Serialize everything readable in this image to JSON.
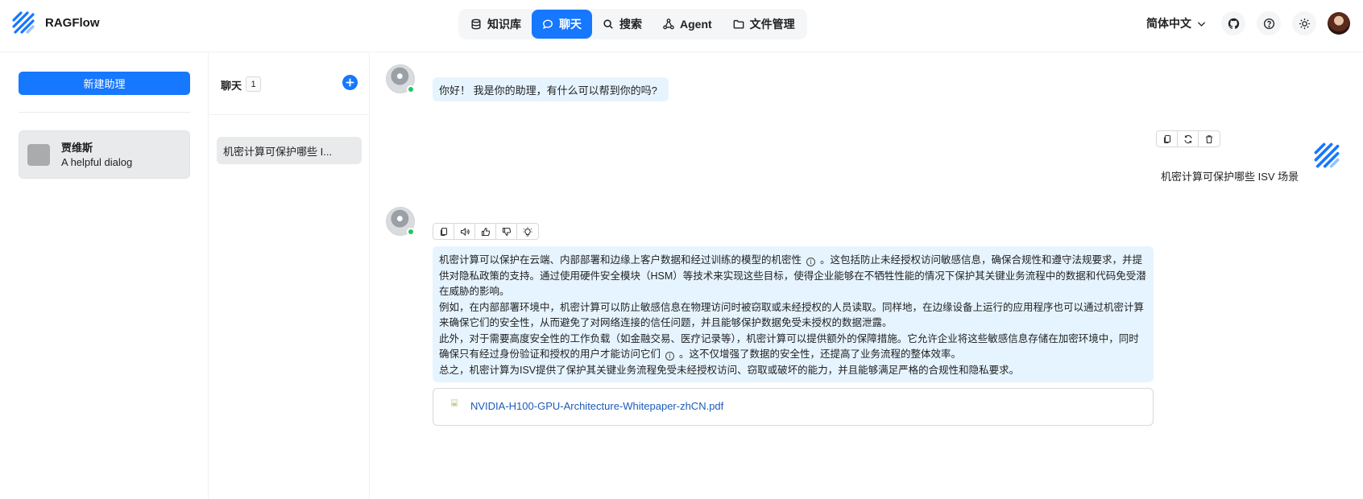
{
  "app": {
    "name": "RAGFlow"
  },
  "nav": {
    "items": [
      {
        "label": "知识库",
        "icon": "database-icon",
        "active": false
      },
      {
        "label": "聊天",
        "icon": "chat-bubble-icon",
        "active": true
      },
      {
        "label": "搜索",
        "icon": "search-icon",
        "active": false
      },
      {
        "label": "Agent",
        "icon": "agent-graph-icon",
        "active": false
      },
      {
        "label": "文件管理",
        "icon": "folder-icon",
        "active": false
      }
    ]
  },
  "header": {
    "language": "简体中文",
    "icons": [
      "github-icon",
      "help-icon",
      "theme-sun-icon",
      "user-avatar"
    ]
  },
  "sidebar": {
    "new_assistant_label": "新建助理",
    "assistants": [
      {
        "name": "贾维斯",
        "description": "A helpful dialog"
      }
    ]
  },
  "conversations": {
    "title": "聊天",
    "count": "1",
    "items": [
      {
        "title": "机密计算可保护哪些 I..."
      }
    ]
  },
  "chat": {
    "greeting": "你好！ 我是你的助理，有什么可以帮到你的吗?",
    "user_message": "机密计算可保护哪些 ISV 场景",
    "answer": {
      "p1a": "机密计算可以保护在云端、内部部署和边缘上客户数据和经过训练的模型的机密性",
      "p1b": "。这包括防止未经授权访问敏感信息，确保合规性和遵守法规要求，并提供对隐私政策的支持。通过使用硬件安全模块（HSM）等技术来实现这些目标，使得企业能够在不牺牲性能的情况下保护其关键业务流程中的数据和代码免受潜在威胁的影响。",
      "p2": "例如，在内部部署环境中，机密计算可以防止敏感信息在物理访问时被窃取或未经授权的人员读取。同样地，在边缘设备上运行的应用程序也可以通过机密计算来确保它们的安全性，从而避免了对网络连接的信任问题，并且能够保护数据免受未授权的数据泄露。",
      "p3a": "此外，对于需要高度安全性的工作负载（如金融交易、医疗记录等），机密计算可以提供额外的保障措施。它允许企业将这些敏感信息存储在加密环境中，同时确保只有经过身份验证和授权的用户才能访问它们",
      "p3b": "。这不仅增强了数据的安全性，还提高了业务流程的整体效率。",
      "p4": "总之，机密计算为ISV提供了保护其关键业务流程免受未经授权访问、窃取或破坏的能力，并且能够满足严格的合规性和隐私要求。",
      "info_glyph": "i"
    },
    "reference_file": "NVIDIA-H100-GPU-Architecture-Whitepaper-zhCN.pdf",
    "user_toolbar": [
      "copy-icon",
      "regenerate-icon",
      "delete-icon"
    ],
    "bot_toolbar": [
      "copy-icon",
      "speaker-icon",
      "thumbs-up-icon",
      "thumbs-down-icon",
      "lightbulb-icon"
    ]
  },
  "colors": {
    "primary": "#1677ff",
    "bubble": "#e6f4ff",
    "online": "#22c55e",
    "link": "#1d5bb8"
  }
}
